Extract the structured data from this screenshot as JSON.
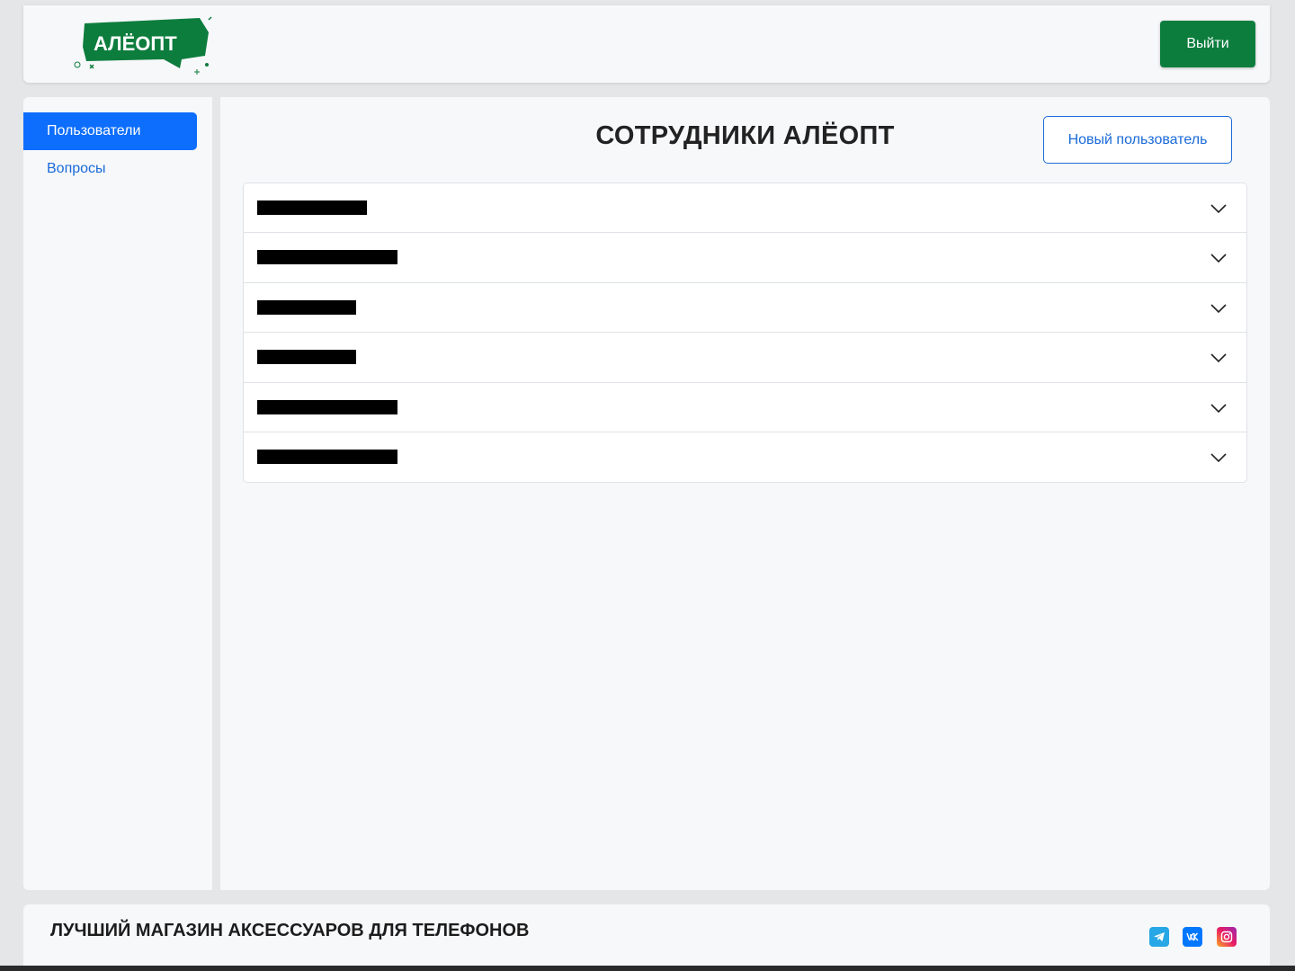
{
  "header": {
    "logo_text": "АЛЁОПТ",
    "logout_label": "Выйти",
    "brand_color": "#0d7d3e"
  },
  "sidebar": {
    "items": [
      {
        "label": "Пользователи",
        "active": true
      },
      {
        "label": "Вопросы",
        "active": false
      }
    ]
  },
  "main": {
    "title": "СОТРУДНИКИ АЛЁОПТ",
    "new_user_label": "Новый пользователь",
    "employees": [
      {
        "name": "█████████"
      },
      {
        "name": "████████████"
      },
      {
        "name": "████████"
      },
      {
        "name": "████████"
      },
      {
        "name": "████████████"
      },
      {
        "name": "████████████"
      }
    ]
  },
  "footer": {
    "title": "ЛУЧШИЙ МАГАЗИН АКСЕССУАРОВ ДЛЯ ТЕЛЕФОНОВ",
    "social": [
      "telegram-icon",
      "vk-icon",
      "instagram-icon"
    ]
  },
  "colors": {
    "accent": "#0d6efd",
    "link": "#1a6ad8",
    "logout": "#0d7d3e"
  }
}
